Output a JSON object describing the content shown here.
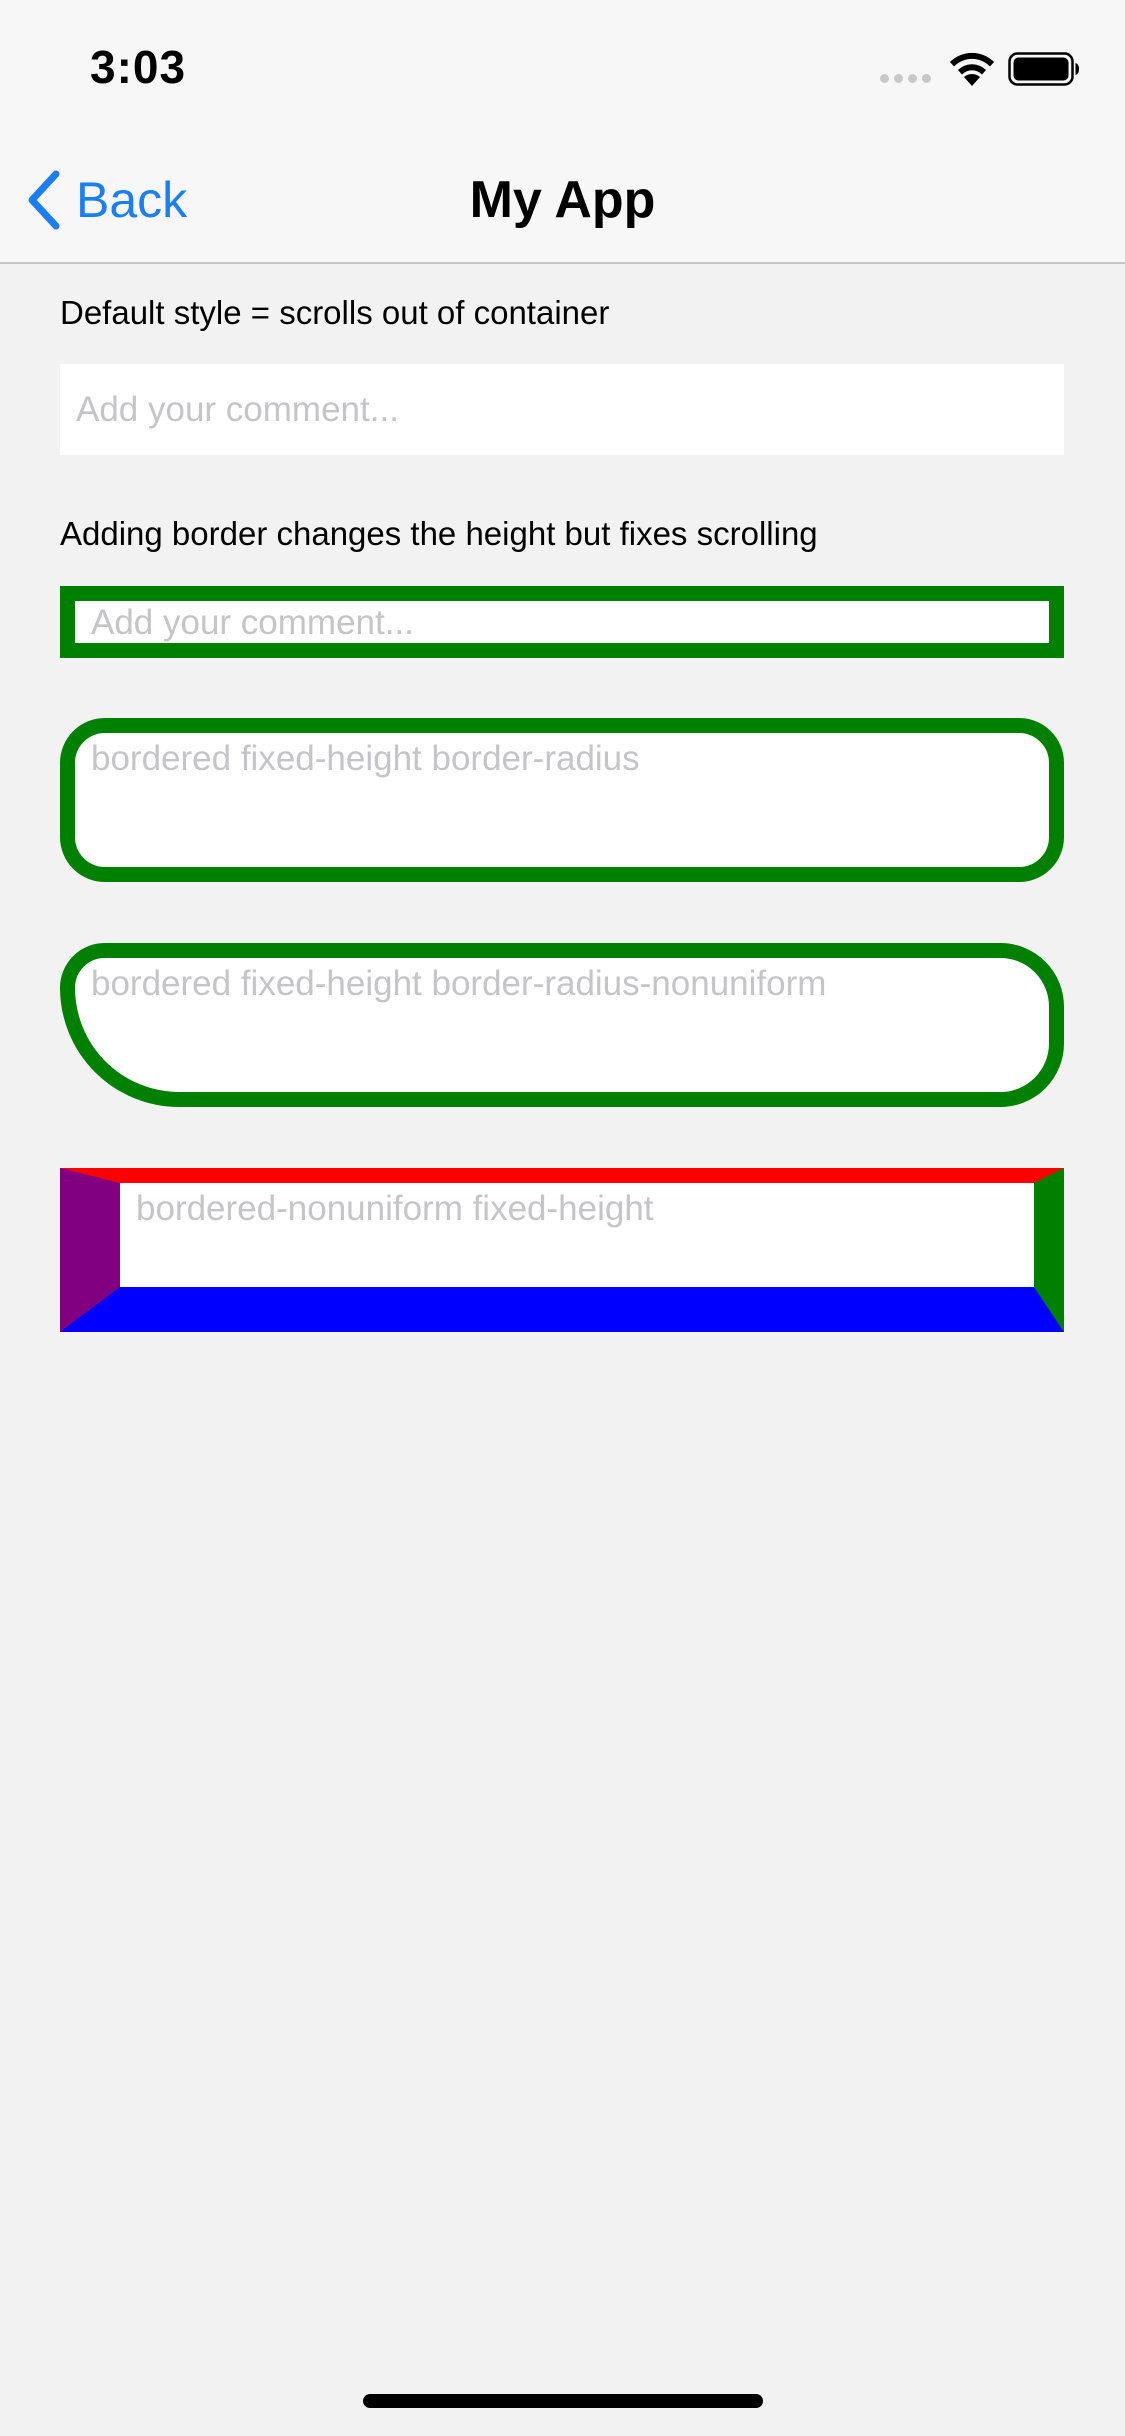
{
  "status_bar": {
    "time": "3:03",
    "icons": [
      "signal-icon",
      "wifi-icon",
      "battery-icon"
    ]
  },
  "nav": {
    "back_label": "Back",
    "title": "My App",
    "accent_color": "#1a7ff5"
  },
  "sections": {
    "default_caption": "Default style = scrolls out of container",
    "default_placeholder": "Add your comment...",
    "bordered_caption": "Adding border changes the height but fixes scrolling",
    "bordered_placeholder": "Add your comment...",
    "radius_placeholder": "bordered fixed-height border-radius",
    "radius_nonuniform_placeholder": "bordered fixed-height border-radius-nonuniform",
    "nonuniform_placeholder": "bordered-nonuniform fixed-height"
  },
  "colors": {
    "border_green": "#008000",
    "border_top": "#ff0000",
    "border_right": "#008000",
    "border_bottom": "#0000ff",
    "border_left": "#800080",
    "placeholder": "#c5c5c9",
    "background": "#f2f2f2"
  }
}
